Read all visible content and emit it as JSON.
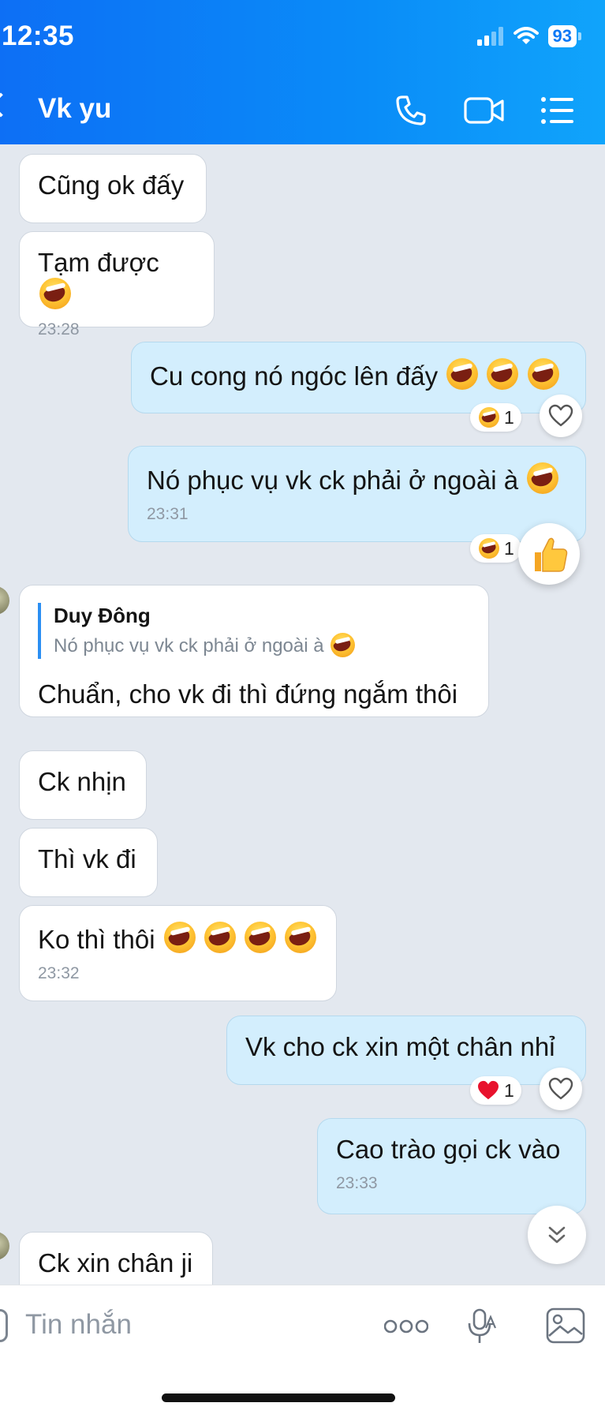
{
  "status_bar": {
    "time": "12:35",
    "battery": "93"
  },
  "header": {
    "back_icon": "chevron-left-icon",
    "title": "Vk yu",
    "icons": [
      "phone-icon",
      "video-call-icon",
      "menu-list-icon"
    ]
  },
  "messages": [
    {
      "direction": "in",
      "text": "Cũng ok đấy"
    },
    {
      "direction": "in",
      "text": "Tạm được",
      "emojis": 1,
      "time": "23:28"
    },
    {
      "direction": "out",
      "text": "Cu cong nó ngóc lên đấy",
      "emojis": 3,
      "reaction": {
        "count": "1"
      }
    },
    {
      "direction": "out",
      "text": "Nó phục vụ vk ck phải ở ngoài à",
      "emojis": 1,
      "time": "23:31",
      "reaction": {
        "count": "1"
      }
    },
    {
      "direction": "in",
      "quote": {
        "name": "Duy Đông",
        "text": "Nó phục vụ vk ck phải ở ngoài à"
      },
      "text": "Chuẩn, cho vk đi thì đứng ngắm thôi"
    },
    {
      "direction": "in",
      "text": "Ck nhịn"
    },
    {
      "direction": "in",
      "text": "Thì vk đi"
    },
    {
      "direction": "in",
      "text": "Ko thì thôi",
      "emojis": 4,
      "time": "23:32"
    },
    {
      "direction": "out",
      "text": "Vk cho ck xin một chân nhỉ",
      "reaction": {
        "count": "1"
      }
    },
    {
      "direction": "out",
      "text": "Cao trào gọi ck vào",
      "time": "23:33"
    },
    {
      "direction": "in",
      "text": "Ck xin chân ji"
    }
  ],
  "composer": {
    "placeholder": "Tin nhắn",
    "icons": [
      "more-options-icon",
      "voice-to-text-icon",
      "image-icon"
    ]
  },
  "colors": {
    "header_start": "#0d6ff5",
    "header_end": "#10a4fb",
    "outgoing_bubble": "#d3eefd",
    "incoming_bubble": "#ffffff",
    "chat_background": "#e3e8ef"
  }
}
